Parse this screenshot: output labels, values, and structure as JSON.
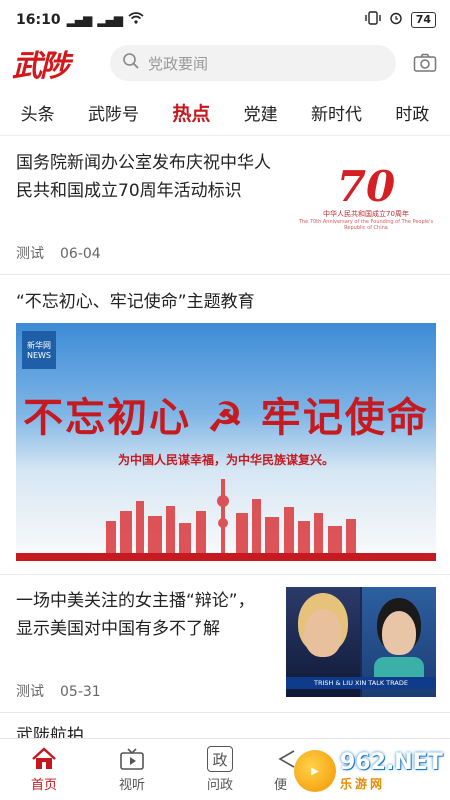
{
  "status_bar": {
    "time": "16:10",
    "signal": "⁴ᴳ",
    "battery": "74"
  },
  "header": {
    "logo": "武陟",
    "search_placeholder": "党政要闻"
  },
  "tabs": [
    {
      "label": "头条"
    },
    {
      "label": "武陟号"
    },
    {
      "label": "热点",
      "active": true
    },
    {
      "label": "党建"
    },
    {
      "label": "新时代"
    },
    {
      "label": "时政"
    }
  ],
  "articles": [
    {
      "title": "国务院新闻办公室发布庆祝中华人民共和国成立70周年活动标识",
      "source": "测试",
      "date": "06-04",
      "thumb": {
        "big": "70",
        "cap1": "中华人民共和国成立70周年",
        "cap2": "The 70th Anniversary of the Founding of The People's Republic of China"
      }
    },
    {
      "title": "“不忘初心、牢记使命”主题教育",
      "banner": {
        "slogan": "不忘初心 ☭ 牢记使命",
        "sub": "为中国人民谋幸福，为中华民族谋复兴。",
        "logo": "新华网 NEWS"
      }
    },
    {
      "title": "一场中美关注的女主播“辩论”，显示美国对中国有多不了解",
      "source": "测试",
      "date": "05-31",
      "thumb": {
        "caption": "TRISH & LIU XIN TALK TRADE"
      }
    },
    {
      "title": "武陟航拍"
    }
  ],
  "bottom_nav": [
    {
      "label": "首页",
      "icon": "home-icon",
      "active": true
    },
    {
      "label": "视听",
      "icon": "tv-icon"
    },
    {
      "label": "问政",
      "icon": "zheng-icon",
      "glyph": "政"
    },
    {
      "label": "便",
      "icon": "share-icon"
    }
  ],
  "watermark": {
    "top": "962.NET",
    "bottom": "乐游网"
  },
  "colors": {
    "brand_red": "#c7161d",
    "text": "#222222",
    "muted": "#666666"
  }
}
